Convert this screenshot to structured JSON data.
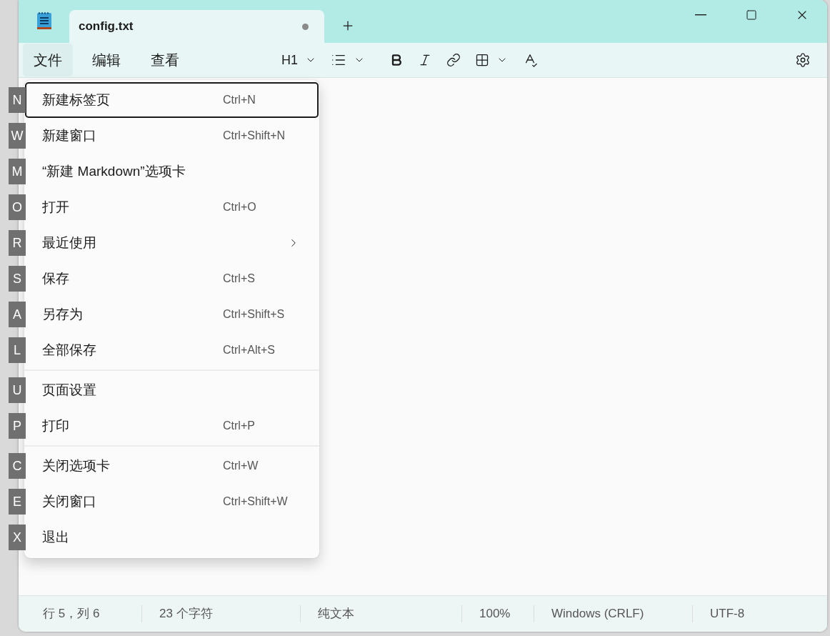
{
  "tabs": [
    {
      "label": "config.txt",
      "selected": true,
      "modified": true
    }
  ],
  "menu_bar": [
    {
      "label": "文件",
      "selected": true
    },
    {
      "label": "编辑",
      "selected": false
    },
    {
      "label": "查看",
      "selected": false
    }
  ],
  "toolbar": {
    "heading": "H1"
  },
  "file_menu": [
    {
      "kind": "item",
      "access_key": "N",
      "label": "新建标签页",
      "shortcut": "Ctrl+N",
      "selected": true
    },
    {
      "kind": "item",
      "access_key": "W",
      "label": "新建窗口",
      "shortcut": "Ctrl+Shift+N",
      "selected": false
    },
    {
      "kind": "item",
      "access_key": "M",
      "label": "“新建 Markdown”选项卡",
      "selected": false
    },
    {
      "kind": "item",
      "access_key": "O",
      "label": "打开",
      "shortcut": "Ctrl+O",
      "selected": false
    },
    {
      "kind": "submenu",
      "access_key": "R",
      "label": "最近使用",
      "selected": false
    },
    {
      "kind": "item",
      "access_key": "S",
      "label": "保存",
      "shortcut": "Ctrl+S",
      "selected": false
    },
    {
      "kind": "item",
      "access_key": "A",
      "label": "另存为",
      "shortcut": "Ctrl+Shift+S",
      "selected": false
    },
    {
      "kind": "item",
      "access_key": "L",
      "label": "全部保存",
      "shortcut": "Ctrl+Alt+S",
      "selected": false
    },
    {
      "kind": "separator"
    },
    {
      "kind": "item",
      "access_key": "U",
      "label": "页面设置",
      "selected": false
    },
    {
      "kind": "item",
      "access_key": "P",
      "label": "打印",
      "shortcut": "Ctrl+P",
      "selected": false
    },
    {
      "kind": "separator"
    },
    {
      "kind": "item",
      "access_key": "C",
      "label": "关闭选项卡",
      "shortcut": "Ctrl+W",
      "selected": false
    },
    {
      "kind": "item",
      "access_key": "E",
      "label": "关闭窗口",
      "shortcut": "Ctrl+Shift+W",
      "selected": false
    },
    {
      "kind": "item",
      "access_key": "X",
      "label": "退出",
      "selected": false
    }
  ],
  "status_bar": [
    {
      "text": "行 5，列 6"
    },
    {
      "text": "23 个字符"
    },
    {
      "text": "纯文本"
    },
    {
      "text": "100%"
    },
    {
      "text": "Windows (CRLF)"
    },
    {
      "text": "UTF-8"
    }
  ]
}
